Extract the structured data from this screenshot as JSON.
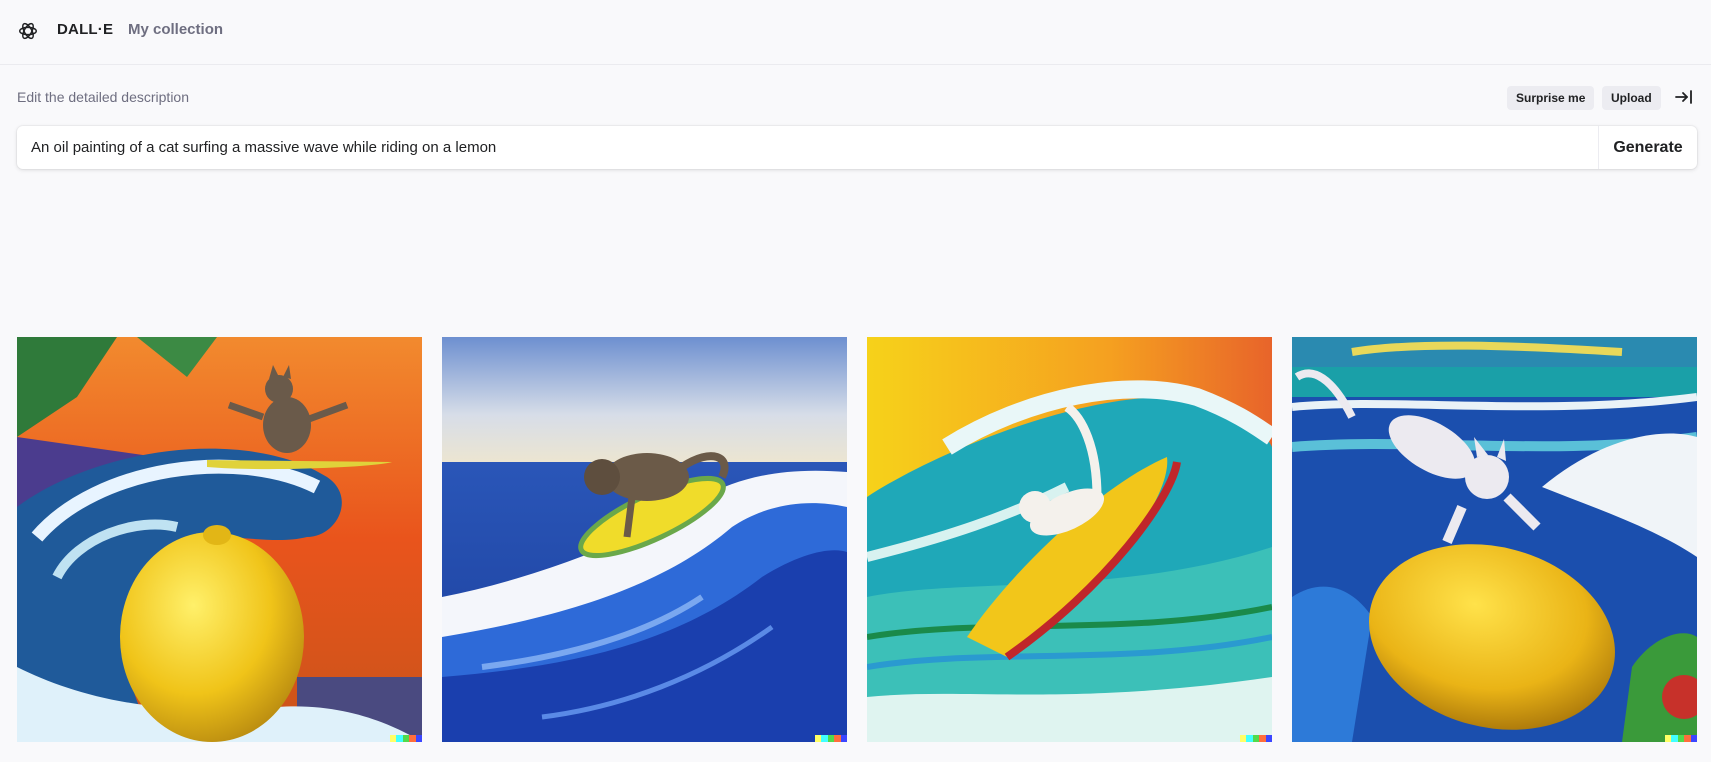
{
  "app": {
    "brand": "DALL·E",
    "nav_collection": "My collection",
    "logo_icon": "openai-logo-icon"
  },
  "prompt": {
    "label": "Edit the detailed description",
    "surprise_label": "Surprise me",
    "upload_label": "Upload",
    "collapse_icon": "arrow-right-bar-icon",
    "value": "An oil painting of a cat surfing a massive wave while riding on a lemon",
    "generate_label": "Generate"
  },
  "results": {
    "images": [
      {
        "subject": "cat surfing orange sunset wave beside lemon"
      },
      {
        "subject": "cat on yellow surfboard blue wave"
      },
      {
        "subject": "white cat on yellow surfboard teal wave"
      },
      {
        "subject": "white cat riding lemon in blue waves"
      }
    ],
    "signature_colors": [
      "#ffff66",
      "#42ffff",
      "#51da4c",
      "#ff6e3c",
      "#3c46ff"
    ]
  }
}
